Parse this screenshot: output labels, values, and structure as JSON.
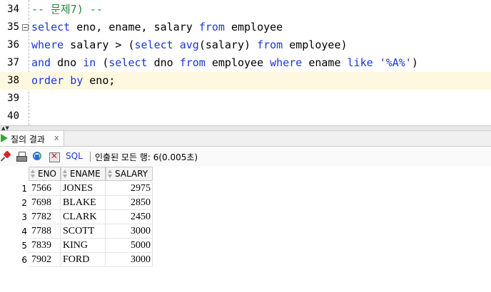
{
  "editor": {
    "lines": [
      {
        "num": "34",
        "tokens": [
          {
            "t": "-- 문제7) --",
            "k": "cm"
          }
        ]
      },
      {
        "num": "35",
        "fold": true,
        "tokens": [
          {
            "t": "select",
            "k": "kw"
          },
          {
            "t": " eno, ename, salary ",
            "k": ""
          },
          {
            "t": "from",
            "k": "kw"
          },
          {
            "t": " employee",
            "k": ""
          }
        ]
      },
      {
        "num": "36",
        "tokens": [
          {
            "t": "where",
            "k": "kw"
          },
          {
            "t": " salary > (",
            "k": ""
          },
          {
            "t": "select",
            "k": "kw"
          },
          {
            "t": " ",
            "k": ""
          },
          {
            "t": "avg",
            "k": "kw"
          },
          {
            "t": "(salary) ",
            "k": ""
          },
          {
            "t": "from",
            "k": "kw"
          },
          {
            "t": " employee)",
            "k": ""
          }
        ]
      },
      {
        "num": "37",
        "tokens": [
          {
            "t": "and",
            "k": "kw"
          },
          {
            "t": " dno ",
            "k": ""
          },
          {
            "t": "in",
            "k": "kw"
          },
          {
            "t": " (",
            "k": ""
          },
          {
            "t": "select",
            "k": "kw"
          },
          {
            "t": " dno ",
            "k": ""
          },
          {
            "t": "from",
            "k": "kw"
          },
          {
            "t": " employee ",
            "k": ""
          },
          {
            "t": "where",
            "k": "kw"
          },
          {
            "t": " ename ",
            "k": ""
          },
          {
            "t": "like",
            "k": "kw"
          },
          {
            "t": " ",
            "k": ""
          },
          {
            "t": "'%A%'",
            "k": "str"
          },
          {
            "t": ")",
            "k": ""
          }
        ]
      },
      {
        "num": "38",
        "current": true,
        "tokens": [
          {
            "t": "order",
            "k": "kw"
          },
          {
            "t": " ",
            "k": ""
          },
          {
            "t": "by",
            "k": "kw"
          },
          {
            "t": " eno;",
            "k": ""
          }
        ]
      },
      {
        "num": "39",
        "tokens": []
      },
      {
        "num": "40",
        "tokens": []
      }
    ]
  },
  "result_tab": {
    "label": "질의 결과",
    "close": "x"
  },
  "toolbar": {
    "sql_label": "SQL",
    "status": "인출된 모든 행: 6(0.005초)"
  },
  "grid": {
    "columns": [
      "ENO",
      "ENAME",
      "SALARY"
    ],
    "rows": [
      {
        "n": "1",
        "eno": "7566",
        "ename": "JONES",
        "salary": "2975"
      },
      {
        "n": "2",
        "eno": "7698",
        "ename": "BLAKE",
        "salary": "2850"
      },
      {
        "n": "3",
        "eno": "7782",
        "ename": "CLARK",
        "salary": "2450"
      },
      {
        "n": "4",
        "eno": "7788",
        "ename": "SCOTT",
        "salary": "3000"
      },
      {
        "n": "5",
        "eno": "7839",
        "ename": "KING",
        "salary": "5000"
      },
      {
        "n": "6",
        "eno": "7902",
        "ename": "FORD",
        "salary": "3000"
      }
    ]
  },
  "colors": {
    "keyword": "#1a36d6",
    "comment": "#1a8a3a",
    "current_line": "#fff8e1"
  }
}
